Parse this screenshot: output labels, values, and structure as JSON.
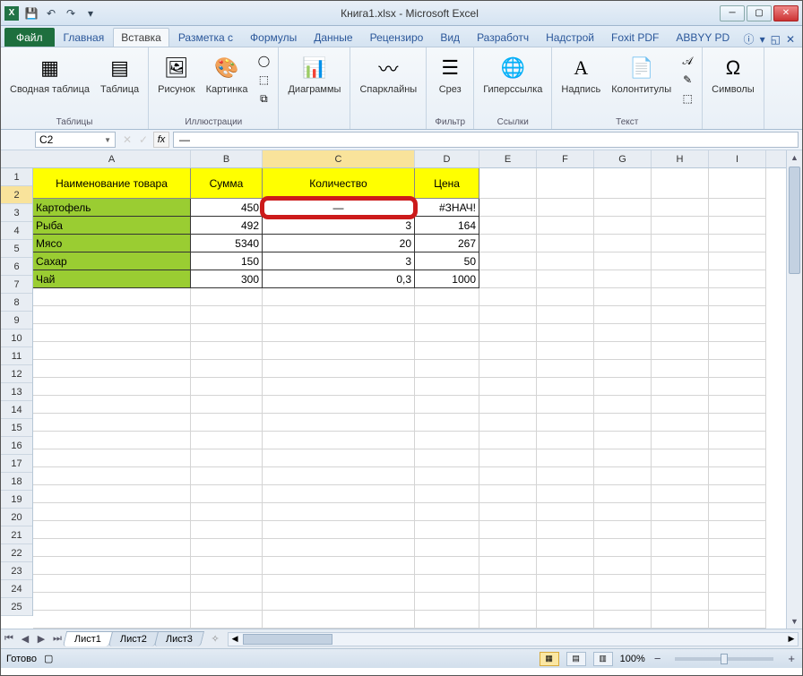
{
  "window": {
    "title": "Книга1.xlsx - Microsoft Excel"
  },
  "qat": {
    "save": "💾",
    "undo": "↶",
    "redo": "↷"
  },
  "tabs": {
    "file": "Файл",
    "items": [
      "Главная",
      "Вставка",
      "Разметка с",
      "Формулы",
      "Данные",
      "Рецензиро",
      "Вид",
      "Разработч",
      "Надстрой",
      "Foxit PDF",
      "ABBYY PD"
    ],
    "active_index": 1
  },
  "ribbon": {
    "groups": {
      "tables": {
        "label": "Таблицы",
        "pivot": "Сводная\nтаблица",
        "table": "Таблица"
      },
      "illus": {
        "label": "Иллюстрации",
        "pic": "Рисунок",
        "clip": "Картинка"
      },
      "charts": {
        "label": "",
        "btn": "Диаграммы"
      },
      "spark": {
        "label": "",
        "btn": "Спарклайны"
      },
      "filter": {
        "label": "Фильтр",
        "btn": "Срез"
      },
      "links": {
        "label": "Ссылки",
        "btn": "Гиперссылка"
      },
      "text": {
        "label": "Текст",
        "a": "Надпись",
        "b": "Колонтитулы"
      },
      "symbols": {
        "label": "",
        "btn": "Символы"
      }
    }
  },
  "namebox": "C2",
  "formula": "—",
  "columns": [
    "A",
    "B",
    "C",
    "D",
    "E",
    "F",
    "G",
    "H",
    "I"
  ],
  "active_col": "C",
  "active_row": 2,
  "table": {
    "headers": {
      "A": "Наименование товара",
      "B": "Сумма",
      "C": "Количество",
      "D": "Цена"
    },
    "rows": [
      {
        "A": "Картофель",
        "B": "450",
        "C": "—",
        "D": "#ЗНАЧ!"
      },
      {
        "A": "Рыба",
        "B": "492",
        "C": "3",
        "D": "164"
      },
      {
        "A": "Мясо",
        "B": "5340",
        "C": "20",
        "D": "267"
      },
      {
        "A": "Сахар",
        "B": "150",
        "C": "3",
        "D": "50"
      },
      {
        "A": "Чай",
        "B": "300",
        "C": "0,3",
        "D": "1000"
      }
    ]
  },
  "sheets": [
    "Лист1",
    "Лист2",
    "Лист3"
  ],
  "status": {
    "ready": "Готово",
    "zoom": "100%"
  }
}
